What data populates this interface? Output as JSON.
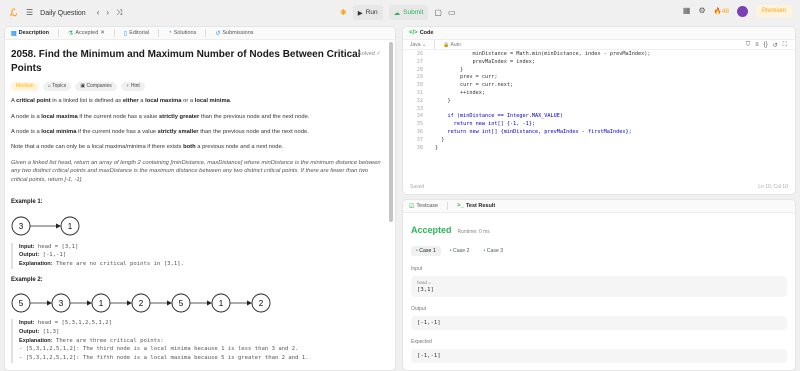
{
  "topbar": {
    "title": "Daily Question",
    "run_label": "Run",
    "submit_label": "Submit",
    "streak_count": "48",
    "premium_label": "Premium"
  },
  "left": {
    "tabs": [
      "Description",
      "Accepted",
      "Editorial",
      "Solutions",
      "Submissions"
    ],
    "title": "2058. Find the Minimum and Maximum Number of Nodes Between Critical Points",
    "solved": "Solved",
    "tags": [
      "Medium",
      "Topics",
      "Companies",
      "Hint"
    ],
    "p1_a": "A ",
    "p1_b": "critical point",
    "p1_c": " in a linked list is defined as ",
    "p1_d": "either",
    "p1_e": " a ",
    "p1_f": "local maxima",
    "p1_g": " or a ",
    "p1_h": "local minima",
    "p1_i": ".",
    "p2_a": "A node is a ",
    "p2_b": "local maxima",
    "p2_c": " if the current node has a value ",
    "p2_d": "strictly greater",
    "p2_e": " than the previous node and the next node.",
    "p3_a": "A node is a ",
    "p3_b": "local minima",
    "p3_c": " if the current node has a value ",
    "p3_d": "strictly smaller",
    "p3_e": " than the previous node and the next node.",
    "p4_a": "Note that a node can only be a local maxima/minima if there exists ",
    "p4_b": "both",
    "p4_c": " a previous node and a next node.",
    "p5": "Given a linked list head, return an array of length 2 containing [minDistance, maxDistance] where minDistance is the minimum distance between any two distinct critical points and maxDistance is the maximum distance between any two distinct critical points. If there are fewer than two critical points, return [-1, -1].",
    "ex1_heading": "Example 1:",
    "ex1_nodes": [
      "3",
      "1"
    ],
    "ex1_input_k": "Input:",
    "ex1_input": " head = [3,1]",
    "ex1_output_k": "Output:",
    "ex1_output": " [-1,-1]",
    "ex1_expl_k": "Explanation:",
    "ex1_expl": " There are no critical points in [3,1].",
    "ex2_heading": "Example 2:",
    "ex2_nodes": [
      "5",
      "3",
      "1",
      "2",
      "5",
      "1",
      "2"
    ],
    "ex2_input_k": "Input:",
    "ex2_input": " head = [5,3,1,2,5,1,2]",
    "ex2_output_k": "Output:",
    "ex2_output": " [1,3]",
    "ex2_expl_k": "Explanation:",
    "ex2_expl": " There are three critical points:",
    "ex2_l1": "- [5,3,1,2,5,1,2]: The third node is a local minima because 1 is less than 3 and 2.",
    "ex2_l2": "- [5,3,1,2,5,1,2]: The fifth node is a local maxima because 5 is greater than 2 and 1."
  },
  "editor": {
    "tab_label": "Code",
    "language": "Java",
    "mode": "Auto",
    "lines": [
      {
        "n": "26",
        "code": "            minDistance = Math.min(minDistance, index - prevMaIndex);"
      },
      {
        "n": "27",
        "code": "            prevMaIndex = index;"
      },
      {
        "n": "28",
        "code": "        }"
      },
      {
        "n": "29",
        "code": "        prev = curr;"
      },
      {
        "n": "30",
        "code": "        curr = curr.next;"
      },
      {
        "n": "31",
        "code": "        ++index;"
      },
      {
        "n": "32",
        "code": "    }"
      },
      {
        "n": "33",
        "code": ""
      },
      {
        "n": "34",
        "code": "    if (minDistance == Integer.MAX_VALUE)"
      },
      {
        "n": "35",
        "code": "      return new int[] {-1, -1};"
      },
      {
        "n": "36",
        "code": "    return new int[] {minDistance, prevMaIndex - firstMaIndex};"
      },
      {
        "n": "37",
        "code": "  }"
      },
      {
        "n": "38",
        "code": "}"
      }
    ],
    "saved": "Saved",
    "cursor": "Ln 10, Col 10"
  },
  "result": {
    "tabs": [
      "Testcase",
      "Test Result"
    ],
    "status": "Accepted",
    "runtime": "Runtime: 0 ms",
    "cases": [
      "Case 1",
      "Case 2",
      "Case 3"
    ],
    "input_label": "Input",
    "input_var": "head =",
    "input_val": "[3,1]",
    "output_label": "Output",
    "output_val": "[-1,-1]",
    "expected_label": "Expected",
    "expected_val": "[-1,-1]"
  }
}
